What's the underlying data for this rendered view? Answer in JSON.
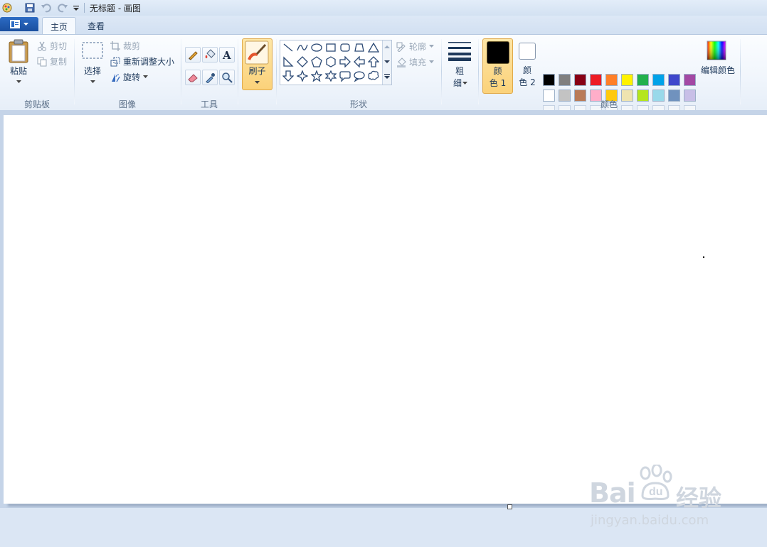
{
  "window": {
    "title": "无标题 - 画图"
  },
  "tabs": [
    {
      "label": "主页"
    },
    {
      "label": "查看"
    }
  ],
  "clipboard": {
    "paste": "粘贴",
    "cut": "剪切",
    "copy": "复制",
    "group": "剪贴板"
  },
  "image": {
    "select": "选择",
    "crop": "裁剪",
    "resize": "重新调整大小",
    "rotate": "旋转",
    "group": "图像"
  },
  "tools": {
    "group": "工具"
  },
  "brushes": {
    "label": "刷子"
  },
  "shapes": {
    "outline": "轮廓",
    "fill": "填充",
    "group": "形状"
  },
  "size": {
    "label_line1": "粗",
    "label_line2": "细"
  },
  "colors": {
    "color1_line1": "颜",
    "color1_line2": "色 1",
    "color2_line1": "颜",
    "color2_line2": "色 2",
    "edit": "编辑颜色",
    "group": "颜色",
    "color1": "#000000",
    "color2": "#ffffff",
    "palette_row1": [
      "#000000",
      "#7f7f7f",
      "#880015",
      "#ed1c24",
      "#ff7f27",
      "#fff200",
      "#22b14c",
      "#00a2e8",
      "#3f48cc",
      "#a349a4"
    ],
    "palette_row2": [
      "#ffffff",
      "#c3c3c3",
      "#b97a57",
      "#ffaec9",
      "#ffc90e",
      "#efe4b0",
      "#b5e61d",
      "#99d9ea",
      "#7092be",
      "#c8bfe7"
    ]
  },
  "watermark": {
    "brand_a": "Bai",
    "brand_b": "经验",
    "url": "jingyan.baidu.com"
  }
}
